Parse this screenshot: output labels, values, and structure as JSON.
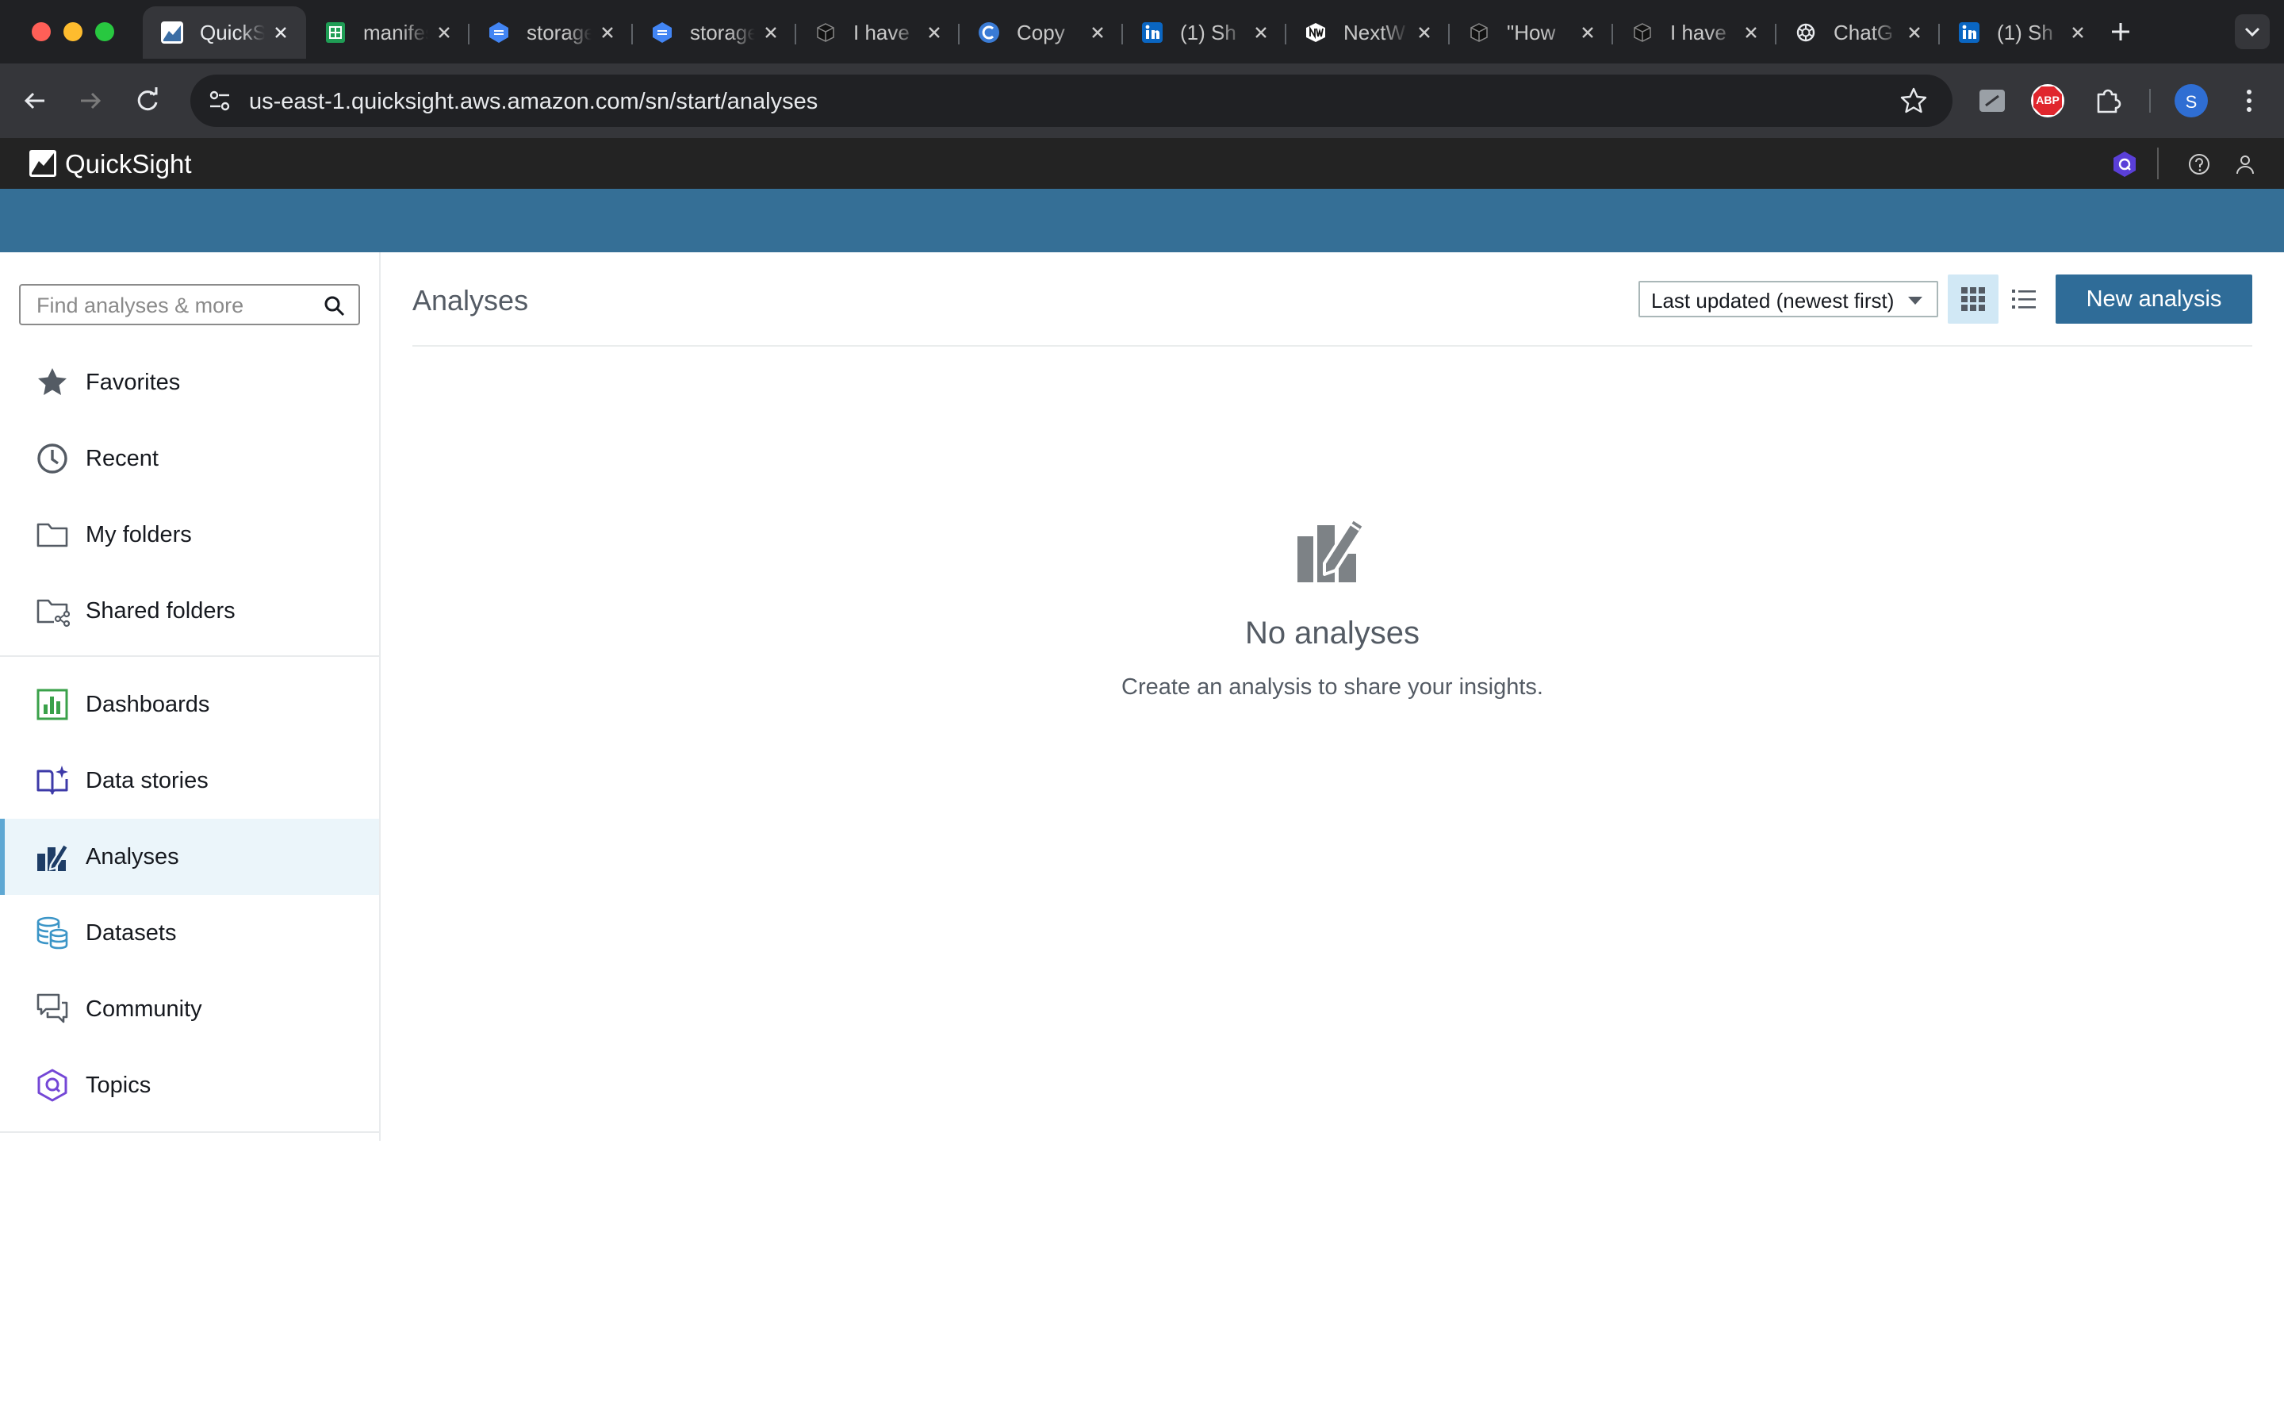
{
  "browser": {
    "tabs": [
      {
        "title": "QuickSight",
        "icon": "quicksight-icon",
        "active": true
      },
      {
        "title": "manifest",
        "icon": "sheet-icon"
      },
      {
        "title": "storage",
        "icon": "cloud-storage-icon"
      },
      {
        "title": "storage",
        "icon": "cloud-storage-icon"
      },
      {
        "title": "I have",
        "icon": "cube-icon"
      },
      {
        "title": "Copy",
        "icon": "copilot-icon"
      },
      {
        "title": "(1) Sh",
        "icon": "linkedin-icon"
      },
      {
        "title": "NextW",
        "icon": "nextw-icon"
      },
      {
        "title": "\"How",
        "icon": "cube-icon"
      },
      {
        "title": "I have",
        "icon": "cube-icon"
      },
      {
        "title": "ChatG",
        "icon": "chatgpt-icon"
      },
      {
        "title": "(1) Sh",
        "icon": "linkedin-icon"
      }
    ],
    "url": "us-east-1.quicksight.aws.amazon.com/sn/start/analyses",
    "profile_initial": "S",
    "abp_label": "ABP"
  },
  "app": {
    "name": "QuickSight"
  },
  "sidebar": {
    "search_placeholder": "Find analyses & more",
    "items": [
      {
        "label": "Favorites",
        "icon": "star-icon"
      },
      {
        "label": "Recent",
        "icon": "clock-icon"
      },
      {
        "label": "My folders",
        "icon": "folder-icon"
      },
      {
        "label": "Shared folders",
        "icon": "shared-folder-icon"
      },
      {
        "label": "Dashboards",
        "icon": "dashboard-icon"
      },
      {
        "label": "Data stories",
        "icon": "data-stories-icon"
      },
      {
        "label": "Analyses",
        "icon": "analyses-icon",
        "active": true
      },
      {
        "label": "Datasets",
        "icon": "datasets-icon"
      },
      {
        "label": "Community",
        "icon": "community-icon"
      },
      {
        "label": "Topics",
        "icon": "topics-icon"
      }
    ]
  },
  "main": {
    "title": "Analyses",
    "sort_selected": "Last updated (newest first)",
    "new_button": "New analysis",
    "empty_title": "No analyses",
    "empty_subtitle": "Create an analysis to share your insights."
  },
  "colors": {
    "header": "#232323",
    "banner": "#356f96",
    "primary_button": "#2f6c98",
    "active_nav": "#ebf5fa"
  }
}
